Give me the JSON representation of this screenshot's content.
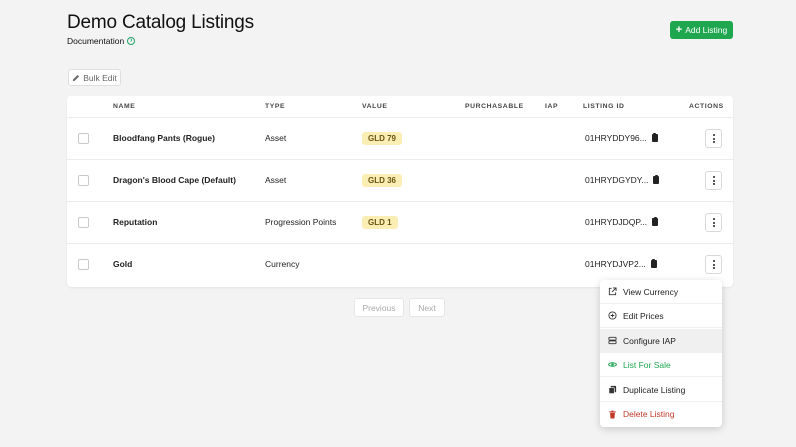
{
  "header": {
    "title": "Demo Catalog Listings",
    "doc_link": "Documentation",
    "add_button": "Add Listing",
    "bulk_button": "Bulk Edit"
  },
  "table": {
    "columns": [
      "NAME",
      "TYPE",
      "VALUE",
      "PURCHASABLE",
      "IAP",
      "LISTING ID",
      "ACTIONS"
    ],
    "rows": [
      {
        "name": "Bloodfang Pants (Rogue)",
        "type": "Asset",
        "value": "GLD 79",
        "listing_id": "01HRYDDY96..."
      },
      {
        "name": "Dragon's Blood Cape (Default)",
        "type": "Asset",
        "value": "GLD 36",
        "listing_id": "01HRYDGYDY..."
      },
      {
        "name": "Reputation",
        "type": "Progression Points",
        "value": "GLD 1",
        "listing_id": "01HRYDJDQP..."
      },
      {
        "name": "Gold",
        "type": "Currency",
        "value": "",
        "listing_id": "01HRYDJVP2..."
      }
    ]
  },
  "pagination": {
    "previous": "Previous",
    "next": "Next"
  },
  "menu": {
    "items": [
      {
        "label": "View Currency",
        "icon": "external-link-icon"
      },
      {
        "label": "Edit Prices",
        "icon": "plus-circle-icon"
      },
      {
        "label": "Configure IAP",
        "icon": "server-icon"
      },
      {
        "label": "List For Sale",
        "icon": "eye-icon"
      },
      {
        "label": "Duplicate Listing",
        "icon": "copy-icon"
      },
      {
        "label": "Delete Listing",
        "icon": "trash-icon"
      }
    ]
  },
  "colors": {
    "accent": "#1fa750",
    "danger": "#c0392b",
    "badge_bg": "#fbeeb5"
  }
}
